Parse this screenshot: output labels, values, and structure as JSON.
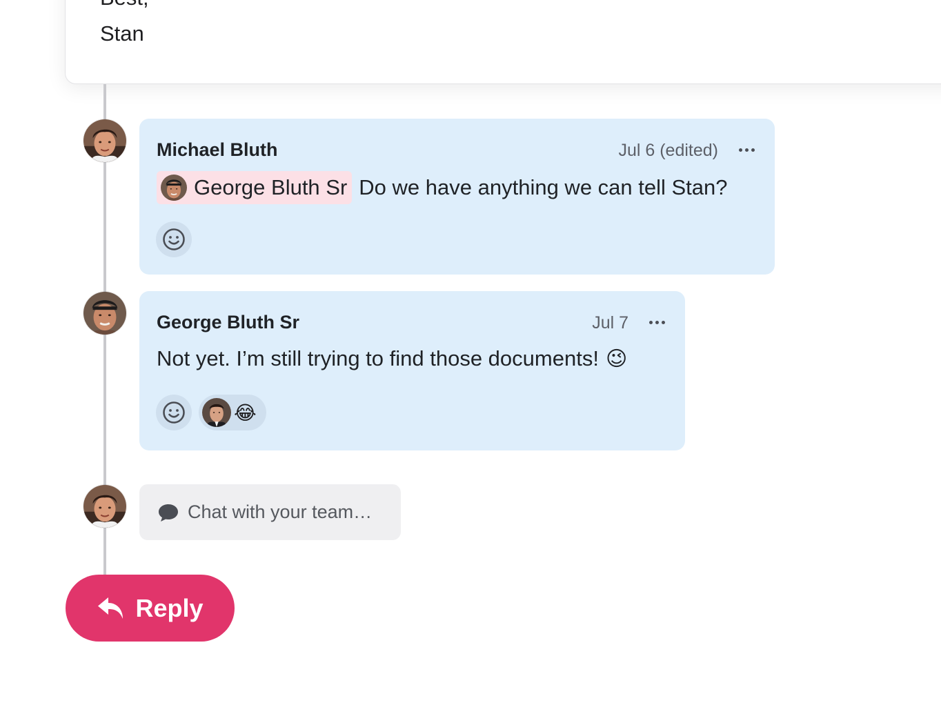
{
  "email": {
    "lines": [
      "Best,",
      "Stan"
    ]
  },
  "messages": [
    {
      "author": "Michael Bluth",
      "date": "Jul 6 (edited)",
      "mention": "George Bluth Sr",
      "text": "Do we have anything we can tell Stan?",
      "avatar": "michael-avatar"
    },
    {
      "author": "George Bluth Sr",
      "date": "Jul 7",
      "text": "Not yet. I’m still trying to find those documents!",
      "emoji": "😉",
      "reaction_emoji": "😂",
      "avatar": "george-avatar"
    }
  ],
  "composer": {
    "placeholder": "Chat with your team…"
  },
  "reply": {
    "label": "Reply"
  },
  "colors": {
    "bubble": "#deeefb",
    "mention": "#fce0e6",
    "reply": "#e1356b",
    "composer": "#efeff1",
    "thread_line": "#c9c9cd"
  }
}
